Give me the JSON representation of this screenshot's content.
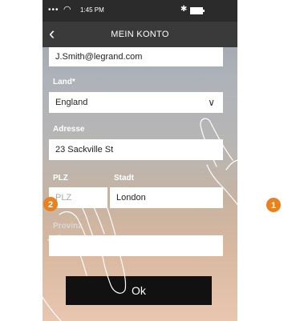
{
  "status": {
    "time": "1:45 PM"
  },
  "header": {
    "title": "MEIN KONTO",
    "back_icon": "chevron-left-icon"
  },
  "form": {
    "email_value": "J.Smith@legrand.com",
    "land_label": "Land*",
    "land_value": "England",
    "adresse_label": "Adresse",
    "adresse_value": "23 Sackville St",
    "plz_label": "PLZ",
    "plz_placeholder": "PLZ",
    "stadt_label": "Stadt",
    "stadt_value": "London",
    "provinz_label": "Provinz"
  },
  "ok_label": "Ok",
  "steps": [
    "1",
    "2"
  ],
  "colors": {
    "badge": "#e8821e",
    "status_bar": "#2b2b2b",
    "nav_bar": "#3a3a3a",
    "button": "#111111"
  }
}
